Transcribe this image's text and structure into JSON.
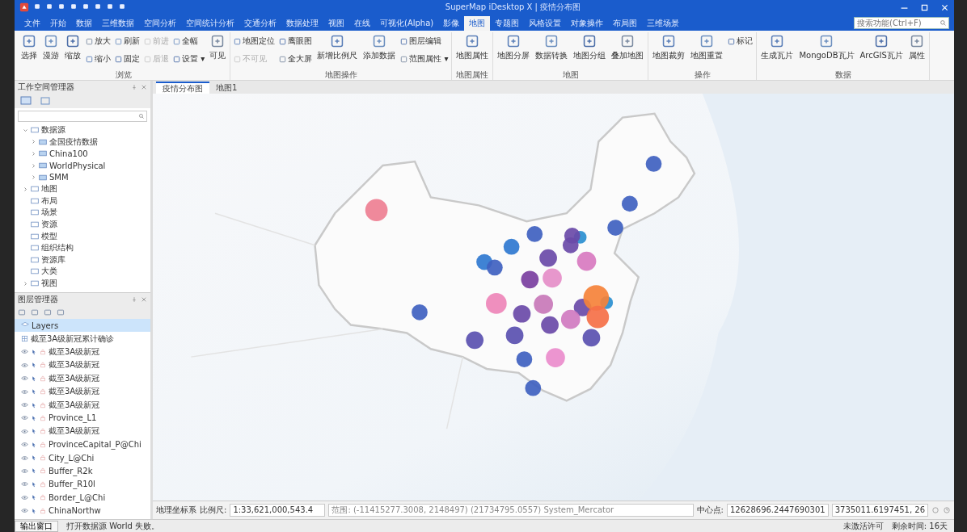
{
  "window": {
    "title": "SuperMap iDesktop X | 疫情分布图"
  },
  "ribbon": {
    "tabs": [
      {
        "label": "文件",
        "selected": false
      },
      {
        "label": "开始",
        "selected": false
      },
      {
        "label": "数据",
        "selected": false
      },
      {
        "label": "三维数据",
        "selected": false
      },
      {
        "label": "空间分析",
        "selected": false
      },
      {
        "label": "空间统计分析",
        "selected": false
      },
      {
        "label": "交通分析",
        "selected": false
      },
      {
        "label": "数据处理",
        "selected": false
      },
      {
        "label": "视图",
        "selected": false
      },
      {
        "label": "在线",
        "selected": false
      },
      {
        "label": "可视化(Alpha)",
        "selected": false
      },
      {
        "label": "影像",
        "selected": false
      },
      {
        "label": "地图",
        "selected": true
      },
      {
        "label": "专题图",
        "selected": false
      },
      {
        "label": "风格设置",
        "selected": false
      },
      {
        "label": "对象操作",
        "selected": false
      },
      {
        "label": "布局图",
        "selected": false
      },
      {
        "label": "三维场景",
        "selected": false
      }
    ],
    "search": {
      "placeholder": "搜索功能(Ctrl+F)"
    },
    "groups": [
      {
        "label": "浏览",
        "items": [
          {
            "kind": "large",
            "label": "选择",
            "disabled": false
          },
          {
            "kind": "large",
            "label": "漫游",
            "disabled": false
          },
          {
            "kind": "large",
            "label": "缩放",
            "disabled": false
          },
          {
            "kind": "small",
            "label": "放大",
            "disabled": false
          },
          {
            "kind": "small",
            "label": "缩小",
            "disabled": false
          },
          {
            "kind": "small",
            "label": "刷新",
            "disabled": false
          },
          {
            "kind": "small",
            "label": "固定",
            "disabled": false
          },
          {
            "kind": "small",
            "label": "前进",
            "disabled": true
          },
          {
            "kind": "small",
            "label": "后退",
            "disabled": true
          },
          {
            "kind": "small",
            "label": "全幅",
            "disabled": false
          },
          {
            "kind": "small",
            "label": "设置 ▾",
            "disabled": false
          },
          {
            "kind": "large",
            "label": "可见",
            "disabled": false
          }
        ]
      },
      {
        "label": "地图操作",
        "items": [
          {
            "kind": "small",
            "label": "地图定位",
            "disabled": false
          },
          {
            "kind": "small",
            "label": "不可见",
            "disabled": true
          },
          {
            "kind": "small",
            "label": "鹰眼图",
            "disabled": false
          },
          {
            "kind": "small",
            "label": "全大屏",
            "disabled": false
          },
          {
            "kind": "large",
            "label": "新增比例尺",
            "disabled": false
          },
          {
            "kind": "large",
            "label": "添加数据",
            "disabled": false
          },
          {
            "kind": "small",
            "label": "图层编辑",
            "disabled": false
          },
          {
            "kind": "small",
            "label": "范围属性 ▾",
            "disabled": false
          }
        ]
      },
      {
        "label": "地图属性",
        "items": [
          {
            "kind": "large",
            "label": "地图属性",
            "disabled": false
          }
        ]
      },
      {
        "label": "地图",
        "items": [
          {
            "kind": "large",
            "label": "地图分屏",
            "disabled": false
          },
          {
            "kind": "large",
            "label": "数据转换",
            "disabled": false
          },
          {
            "kind": "large",
            "label": "地图分组",
            "disabled": false
          },
          {
            "kind": "large",
            "label": "叠加地图",
            "disabled": false
          }
        ]
      },
      {
        "label": "操作",
        "items": [
          {
            "kind": "large",
            "label": "地图裁剪",
            "disabled": false
          },
          {
            "kind": "large",
            "label": "地图重置",
            "disabled": false
          },
          {
            "kind": "small",
            "label": "标记",
            "disabled": false
          }
        ]
      },
      {
        "label": "数据",
        "items": [
          {
            "kind": "large",
            "label": "生成瓦片",
            "disabled": false
          },
          {
            "kind": "large",
            "label": "MongoDB瓦片",
            "disabled": false
          },
          {
            "kind": "large",
            "label": "ArcGIS瓦片",
            "disabled": false
          },
          {
            "kind": "large",
            "label": "属性",
            "disabled": false
          }
        ]
      }
    ]
  },
  "workspace": {
    "title": "工作空间管理器",
    "items": [
      {
        "label": "数据源",
        "expanded": true,
        "children": [
          {
            "label": "全国疫情数据",
            "expanded": false
          },
          {
            "label": "China100",
            "expanded": false
          },
          {
            "label": "WorldPhysical",
            "expanded": false
          },
          {
            "label": "SMM",
            "expanded": false
          }
        ]
      },
      {
        "label": "地图",
        "expanded": false
      },
      {
        "label": "布局"
      },
      {
        "label": "场景"
      },
      {
        "label": "资源"
      },
      {
        "label": "模型"
      },
      {
        "label": "组织结构"
      },
      {
        "label": "资源库"
      },
      {
        "label": "大类"
      },
      {
        "label": "视图",
        "expanded": false
      }
    ]
  },
  "layers": {
    "title": "图层管理器",
    "items": [
      {
        "label": "Layers",
        "selected": true
      },
      {
        "label": "截至3A级新冠累计确诊",
        "selected": false
      },
      {
        "label": "截至3A级新冠",
        "selected": false
      },
      {
        "label": "截至3A级新冠",
        "selected": false
      },
      {
        "label": "截至3A级新冠",
        "selected": false
      },
      {
        "label": "截至3A级新冠",
        "selected": false
      },
      {
        "label": "截至3A级新冠",
        "selected": false
      },
      {
        "label": "Province_L1",
        "selected": false
      },
      {
        "label": "截至3A级新冠",
        "selected": false
      },
      {
        "label": "ProvinceCapital_P@Chi",
        "selected": false
      },
      {
        "label": "City_L@Chi",
        "selected": false
      },
      {
        "label": "Buffer_R2k",
        "selected": false
      },
      {
        "label": "Buffer_R10l",
        "selected": false
      },
      {
        "label": "Border_L@Chi",
        "selected": false
      },
      {
        "label": "ChinaNorthw",
        "selected": false
      }
    ]
  },
  "map_tabs": [
    {
      "label": "疫情分布图",
      "selected": true
    },
    {
      "label": "地图1",
      "selected": false
    }
  ],
  "map_bar": {
    "label_1": "地理坐标系",
    "scale_label": "比例尺:",
    "scale": "1:33,621,000,543.4",
    "extent": "范围: (-11415277.3008, 2148497) (21734795.0557) System_Mercator",
    "center_label": "中心点:",
    "center": "12628696.2447690301",
    "coord": "3735011.6197451, 26"
  },
  "status_bar": {
    "output_tab": "输出窗口",
    "message": "打开数据源 World 失败。",
    "license": "未激活许可",
    "remaining": "剩余时间: 16天"
  }
}
